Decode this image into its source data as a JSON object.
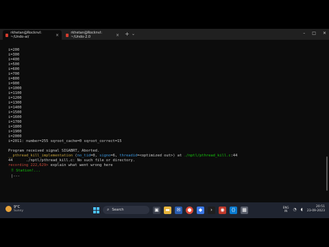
{
  "tabs": [
    {
      "label": "rkhetan@Rocknvl: ~/Undo-ai/",
      "close": "×"
    },
    {
      "label": "rkhetan@Rocknvl: ~/Undo-2.0",
      "close": "×"
    }
  ],
  "new_tab": "+",
  "new_tab_menu": "⌄",
  "window_controls": {
    "minimize": "–",
    "maximize": "□",
    "close": "✕"
  },
  "terminal": {
    "iterations": [
      "i=200",
      "i=300",
      "i=400",
      "i=500",
      "i=600",
      "i=700",
      "i=800",
      "i=900",
      "i=1000",
      "i=1100",
      "i=1200",
      "i=1300",
      "i=1400",
      "i=1500",
      "i=1600",
      "i=1700",
      "i=1800",
      "i=1900",
      "i=2000"
    ],
    "result_line": "i=2011: number=255 sqroot_cache=0 sqroot_correct=15",
    "signal_line": "Program received signal SIGABRT, Aborted.",
    "frame_func": "__pthread_kill_implementation",
    "frame_args_a": " (",
    "frame_arg1_name": "no_tid",
    "frame_arg1_val": "=0, ",
    "frame_arg2_name": "signo",
    "frame_arg2_val": "=6, ",
    "frame_arg3_name": "threadid",
    "frame_arg3_val": "=<optimized out>) at ",
    "frame_file": "./nptl/pthread_kill.c",
    "frame_line": ":44",
    "source_error": "44\t./nptl/pthread_kill.c: No such file or directory.",
    "prompt_label": "recording 222,629>",
    "prompt_command": " explain what went wrong here",
    "status_text": "⠿ Station!...",
    "status_line2": "|---"
  },
  "taskbar": {
    "weather_temp": "9°C",
    "weather_cond": "Sunny",
    "search_placeholder": "Search",
    "search_glyph": "⌕",
    "lang_top": "ENG",
    "lang_bottom": "IN",
    "wifi_glyph": "◔",
    "volume_glyph": "◖",
    "time": "20:51",
    "date": "23-09-2023"
  },
  "colors": {
    "terminal_bg": "#0c0c0c",
    "taskbar_bg": "#1f2430",
    "accent": "#4cc2ff"
  }
}
